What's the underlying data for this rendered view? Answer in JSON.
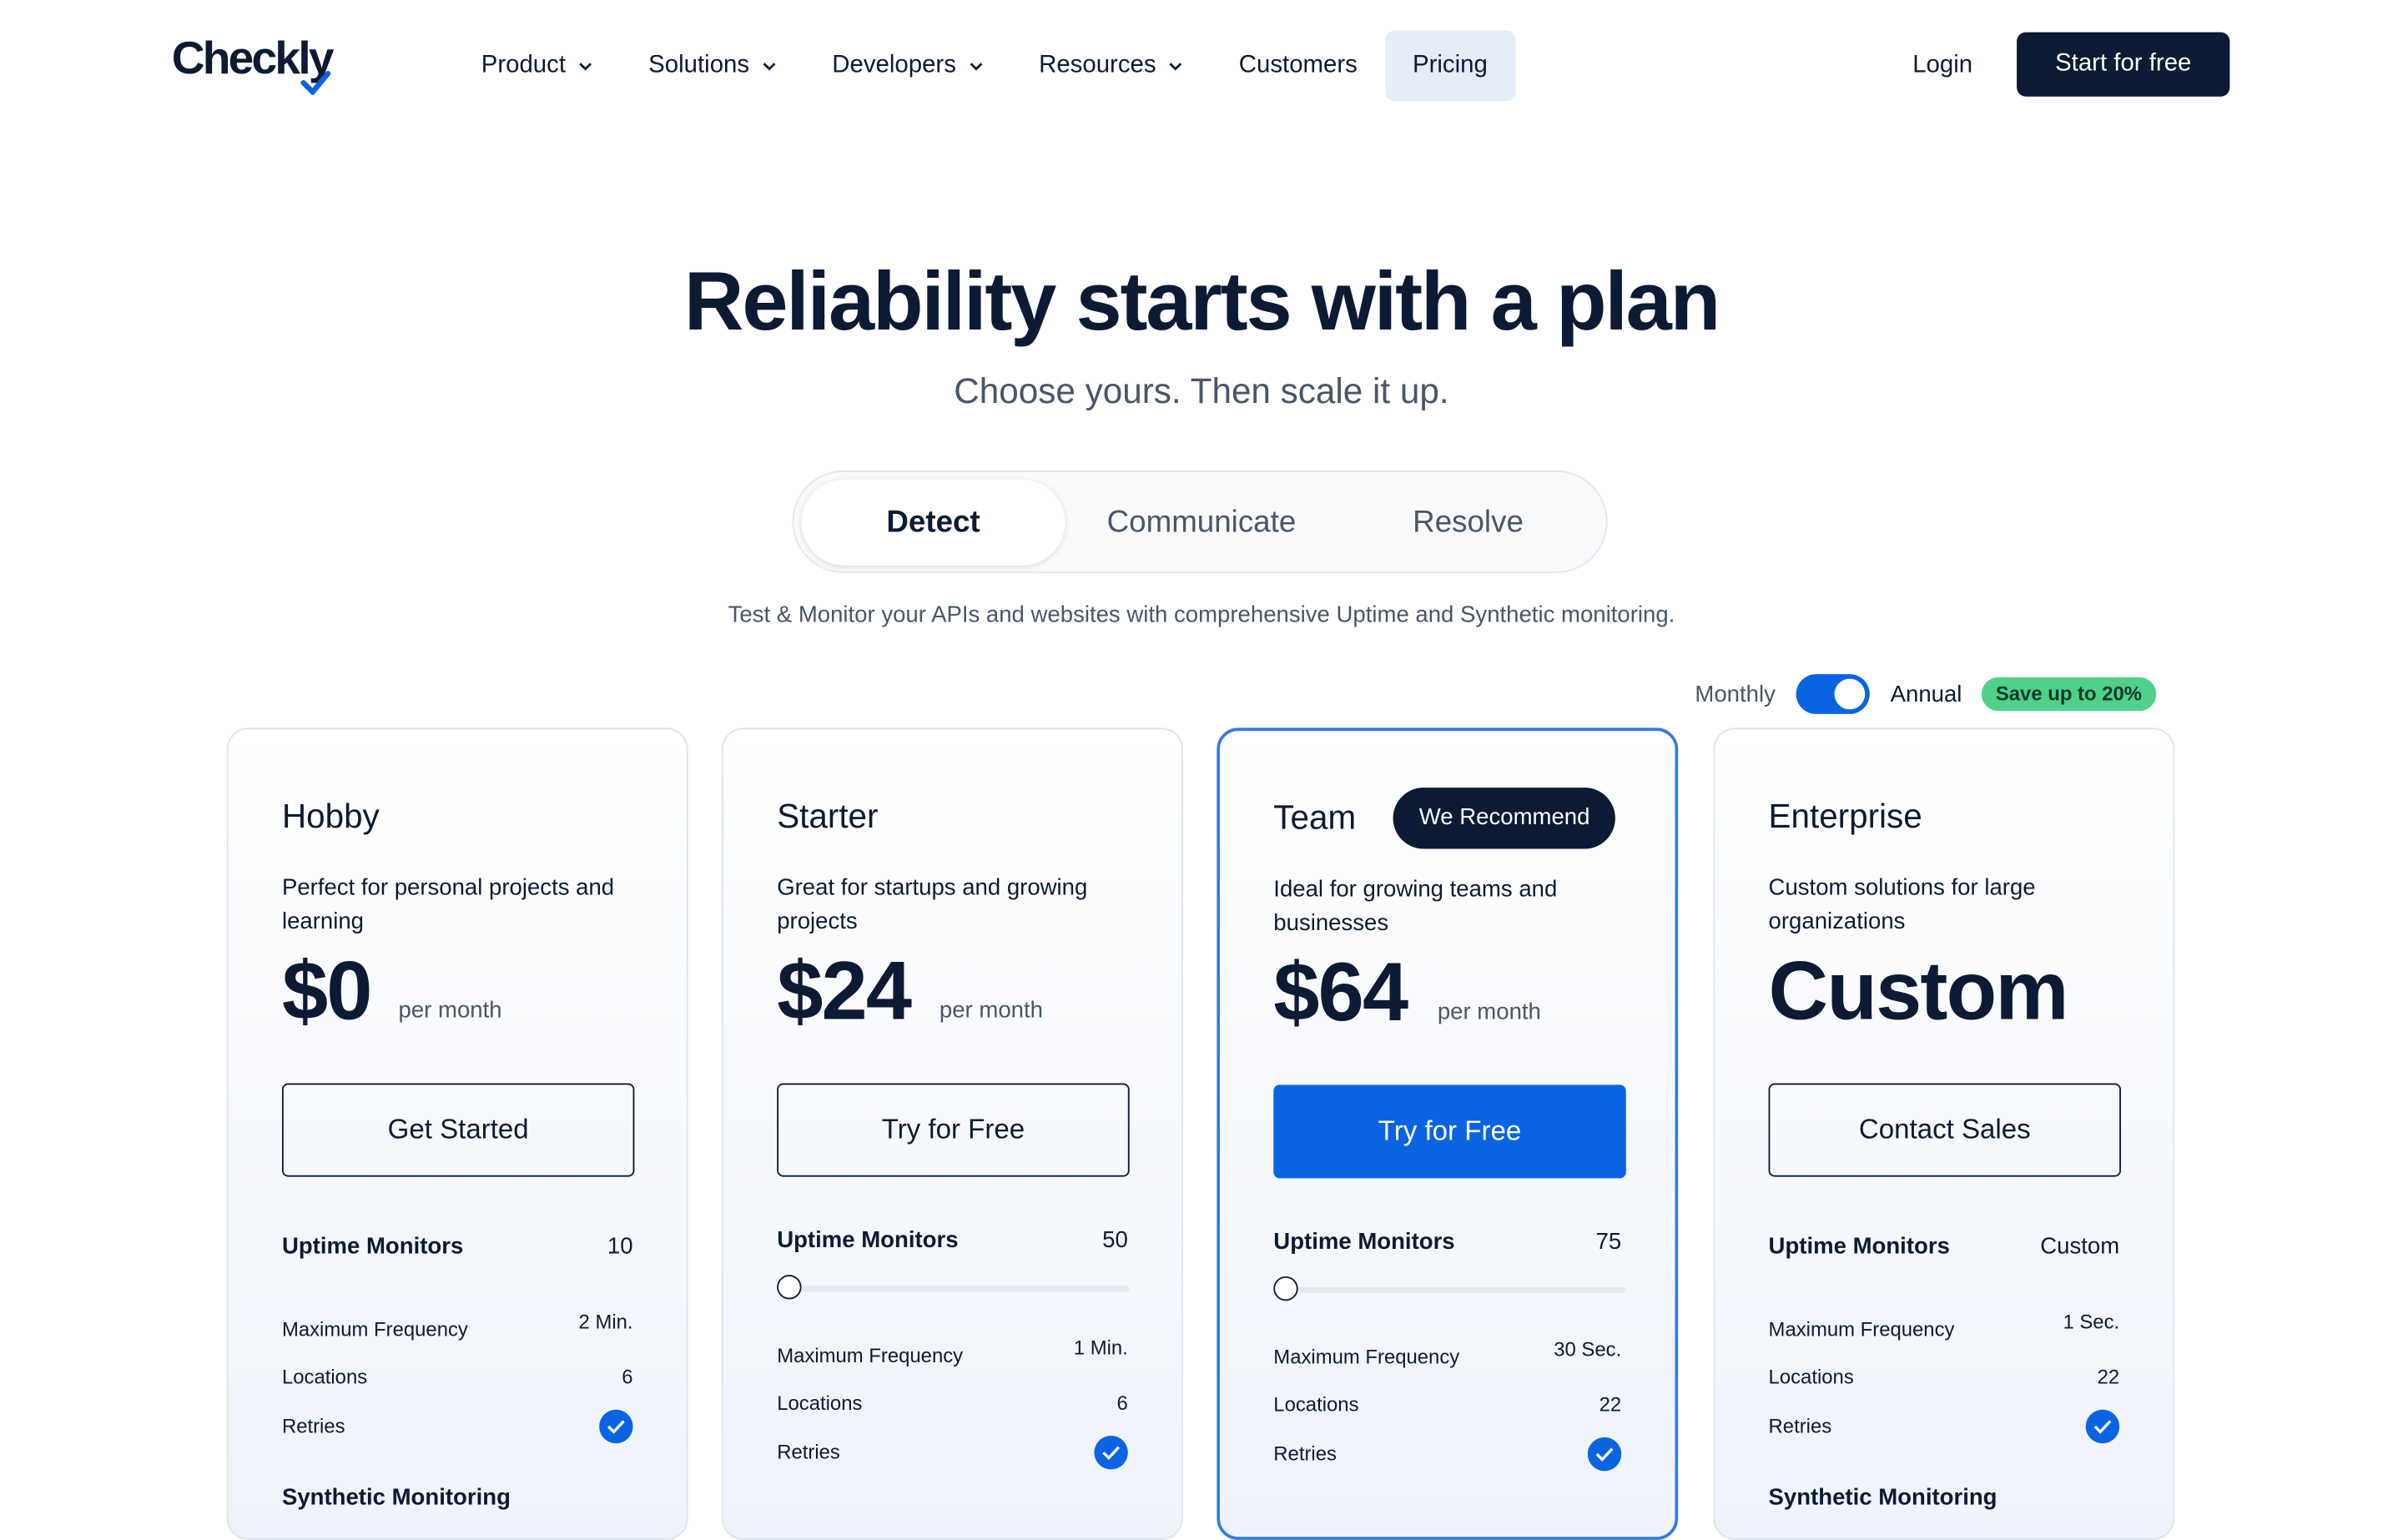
{
  "nav": {
    "logo": "Checkly",
    "items": [
      {
        "label": "Product",
        "dropdown": true
      },
      {
        "label": "Solutions",
        "dropdown": true
      },
      {
        "label": "Developers",
        "dropdown": true
      },
      {
        "label": "Resources",
        "dropdown": true
      },
      {
        "label": "Customers",
        "dropdown": false
      },
      {
        "label": "Pricing",
        "dropdown": false,
        "active": true
      }
    ],
    "login": "Login",
    "cta": "Start for free"
  },
  "hero": {
    "title": "Reliability starts with a plan",
    "subtitle": "Choose yours. Then scale it up."
  },
  "tabs": [
    "Detect",
    "Communicate",
    "Resolve"
  ],
  "active_tab": "Detect",
  "tagline": "Test & Monitor your APIs and websites with comprehensive Uptime and Synthetic monitoring.",
  "billing": {
    "monthly": "Monthly",
    "annual": "Annual",
    "save_badge": "Save up to 20%",
    "annual_selected": true
  },
  "colors": {
    "brand_dark": "#0c1a33",
    "accent_blue": "#0a64e1",
    "save_green": "#4fd18b"
  },
  "plans": [
    {
      "name": "Hobby",
      "description": "Perfect for personal projects and learning",
      "price": "$0",
      "per": "per month",
      "button": "Get Started",
      "uptime_label": "Uptime Monitors",
      "uptime_value": "10",
      "freq_label": "Maximum Frequency",
      "freq_value": "2 Min.",
      "locations_label": "Locations",
      "locations_value": "6",
      "retries_label": "Retries",
      "synthetic_label": "Synthetic Monitoring"
    },
    {
      "name": "Starter",
      "description": "Great for startups and growing projects",
      "price": "$24",
      "per": "per month",
      "button": "Try for Free",
      "uptime_label": "Uptime Monitors",
      "uptime_value": "50",
      "freq_label": "Maximum Frequency",
      "freq_value": "1 Min.",
      "locations_label": "Locations",
      "locations_value": "6",
      "retries_label": "Retries"
    },
    {
      "name": "Team",
      "badge": "We Recommend",
      "description": "Ideal for growing teams and businesses",
      "price": "$64",
      "per": "per month",
      "button": "Try for Free",
      "uptime_label": "Uptime Monitors",
      "uptime_value": "75",
      "freq_label": "Maximum Frequency",
      "freq_value": "30 Sec.",
      "locations_label": "Locations",
      "locations_value": "22",
      "retries_label": "Retries"
    },
    {
      "name": "Enterprise",
      "description": "Custom solutions for large organizations",
      "price": "Custom",
      "button": "Contact Sales",
      "uptime_label": "Uptime Monitors",
      "uptime_value": "Custom",
      "freq_label": "Maximum Frequency",
      "freq_value": "1 Sec.",
      "locations_label": "Locations",
      "locations_value": "22",
      "retries_label": "Retries",
      "synthetic_label": "Synthetic Monitoring"
    }
  ]
}
